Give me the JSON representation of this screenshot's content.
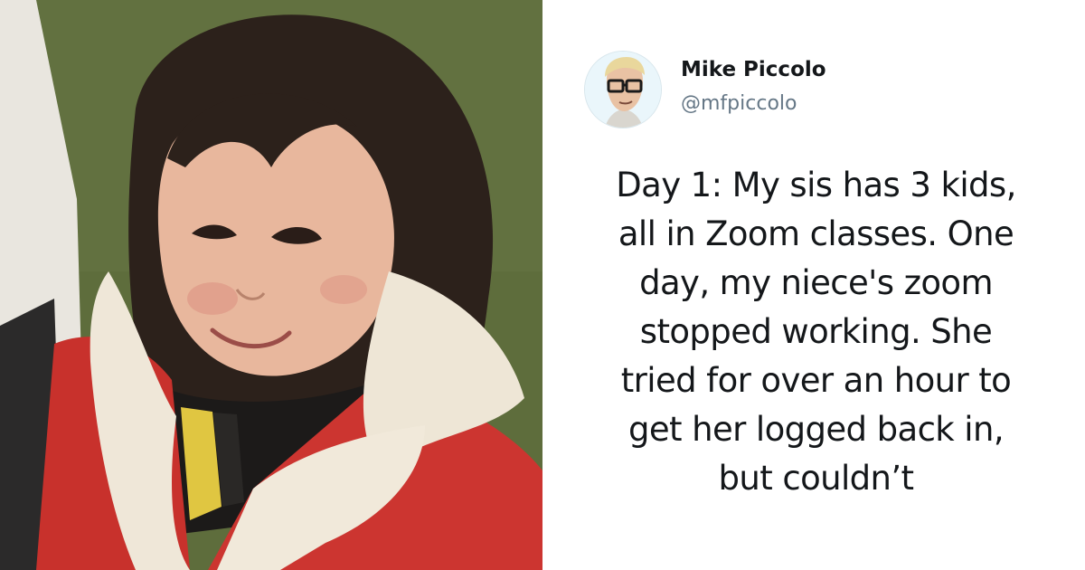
{
  "tweet": {
    "author_name": "Mike Piccolo",
    "author_handle": "@mfpiccolo",
    "text_lines": [
      "Day 1: My sis has 3 kids,",
      "all in Zoom classes. One",
      "day, my niece's zoom",
      "stopped working. She",
      "tried for over an hour to",
      "get her logged back in,",
      "but couldn’t"
    ]
  },
  "colors": {
    "name_text": "#14171a",
    "handle_text": "#657786",
    "body_text": "#14171a",
    "background": "#ffffff"
  },
  "icons": {
    "avatar": "cartoon-man-with-glasses-avatar"
  }
}
